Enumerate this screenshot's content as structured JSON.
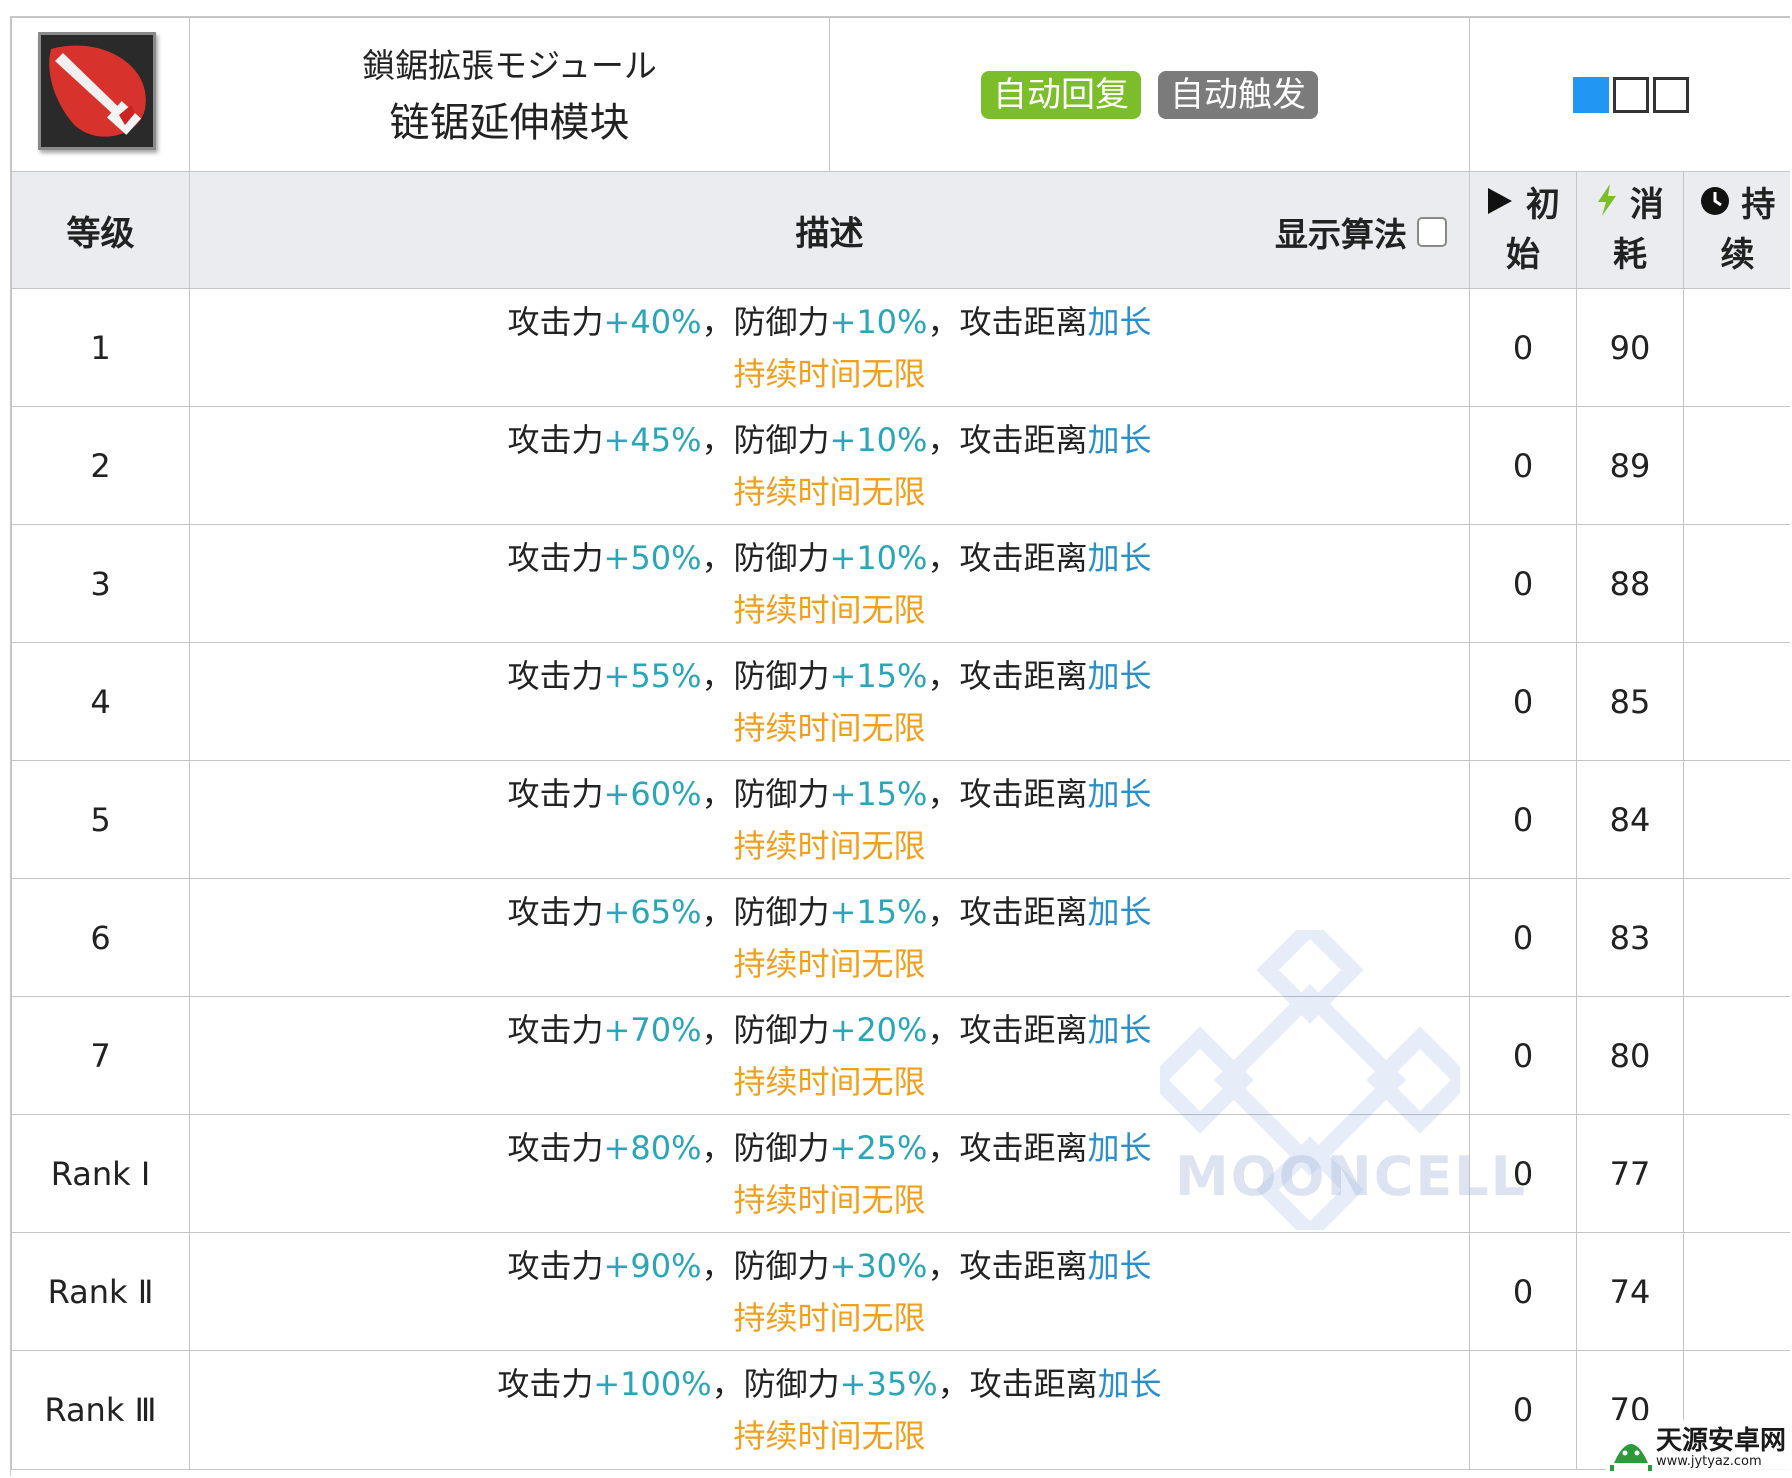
{
  "skill": {
    "icon": "chainsaw-skill-icon",
    "name_jp": "鎖鋸拡張モジュール",
    "name_cn": "链锯延伸模块",
    "tags": [
      {
        "label": "自动回复",
        "color": "#7cbd2a"
      },
      {
        "label": "自动触发",
        "color": "#7b7b7b"
      }
    ],
    "range_squares": [
      true,
      false,
      false
    ]
  },
  "columns": {
    "level": "等级",
    "desc": "描述",
    "show_formula": "显示算法",
    "initial": [
      "初",
      "始"
    ],
    "cost": [
      "消",
      "耗"
    ],
    "duration": [
      "持",
      "续"
    ]
  },
  "text": {
    "atk": "攻击力",
    "def": "防御力",
    "sep": "，",
    "range": "攻击距离",
    "range_val": "加长",
    "duration_line": "持续时间无限"
  },
  "rows": [
    {
      "level": "1",
      "atk": "+40%",
      "def": "+10%",
      "initial": "0",
      "cost": "90",
      "duration": ""
    },
    {
      "level": "2",
      "atk": "+45%",
      "def": "+10%",
      "initial": "0",
      "cost": "89",
      "duration": ""
    },
    {
      "level": "3",
      "atk": "+50%",
      "def": "+10%",
      "initial": "0",
      "cost": "88",
      "duration": ""
    },
    {
      "level": "4",
      "atk": "+55%",
      "def": "+15%",
      "initial": "0",
      "cost": "85",
      "duration": ""
    },
    {
      "level": "5",
      "atk": "+60%",
      "def": "+15%",
      "initial": "0",
      "cost": "84",
      "duration": ""
    },
    {
      "level": "6",
      "atk": "+65%",
      "def": "+15%",
      "initial": "0",
      "cost": "83",
      "duration": ""
    },
    {
      "level": "7",
      "atk": "+70%",
      "def": "+20%",
      "initial": "0",
      "cost": "80",
      "duration": ""
    },
    {
      "level": "Rank Ⅰ",
      "atk": "+80%",
      "def": "+25%",
      "initial": "0",
      "cost": "77",
      "duration": ""
    },
    {
      "level": "Rank Ⅱ",
      "atk": "+90%",
      "def": "+30%",
      "initial": "0",
      "cost": "74",
      "duration": ""
    },
    {
      "level": "Rank Ⅲ",
      "atk": "+100%",
      "def": "+35%",
      "initial": "0",
      "cost": "70",
      "duration": ""
    }
  ],
  "watermark": "MOONCELL",
  "logo": {
    "title": "天源安卓网",
    "url": "www.jytyaz.com"
  },
  "colors": {
    "value_teal": "#2aa6b8",
    "value_blue": "#2a8fc9",
    "duration_orange": "#f0a020",
    "header_bg": "#eaecf0",
    "range_active": "#2196f3"
  }
}
